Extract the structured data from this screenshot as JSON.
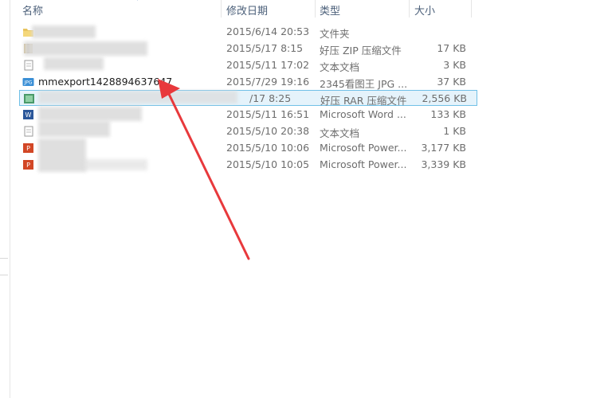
{
  "columns": {
    "name": "名称",
    "date": "修改日期",
    "type": "类型",
    "size": "大小"
  },
  "rows": [
    {
      "name": "",
      "date": "2015/6/14 20:53",
      "type": "文件夹",
      "size": "",
      "icon": "folder-icon"
    },
    {
      "name": "",
      "date": "2015/5/17 8:15",
      "type": "好压 ZIP 压缩文件",
      "size": "17 KB",
      "icon": "zip-archive-icon"
    },
    {
      "name": "",
      "date": "2015/5/11 17:02",
      "type": "文本文档",
      "size": "3 KB",
      "icon": "text-document-icon"
    },
    {
      "name": "mmexport1428894637647",
      "date": "2015/7/29 19:16",
      "type": "2345看图王 JPG ...",
      "size": "37 KB",
      "icon": "jpg-image-icon",
      "icon_label": "JPG"
    },
    {
      "name": "",
      "date": "/17 8:25",
      "type": "好压 RAR 压缩文件",
      "size": "2,556 KB",
      "icon": "rar-archive-icon",
      "selected": true
    },
    {
      "name": "",
      "date": "2015/5/11 16:51",
      "type": "Microsoft Word ...",
      "size": "133 KB",
      "icon": "word-document-icon"
    },
    {
      "name": "",
      "date": "2015/5/10 20:38",
      "type": "文本文档",
      "size": "1 KB",
      "icon": "text-document-icon"
    },
    {
      "name": "",
      "date": "2015/5/10 10:06",
      "type": "Microsoft Power...",
      "size": "3,177 KB",
      "icon": "powerpoint-icon"
    },
    {
      "name": "",
      "date": "2015/5/10 10:05",
      "type": "Microsoft Power...",
      "size": "3,339 KB",
      "icon": "powerpoint-icon"
    }
  ],
  "colors": {
    "arrow": "#e8393c",
    "selection_bg": "#e5f3fb",
    "selection_border": "#70c0e7",
    "header_text": "#4c607a"
  }
}
